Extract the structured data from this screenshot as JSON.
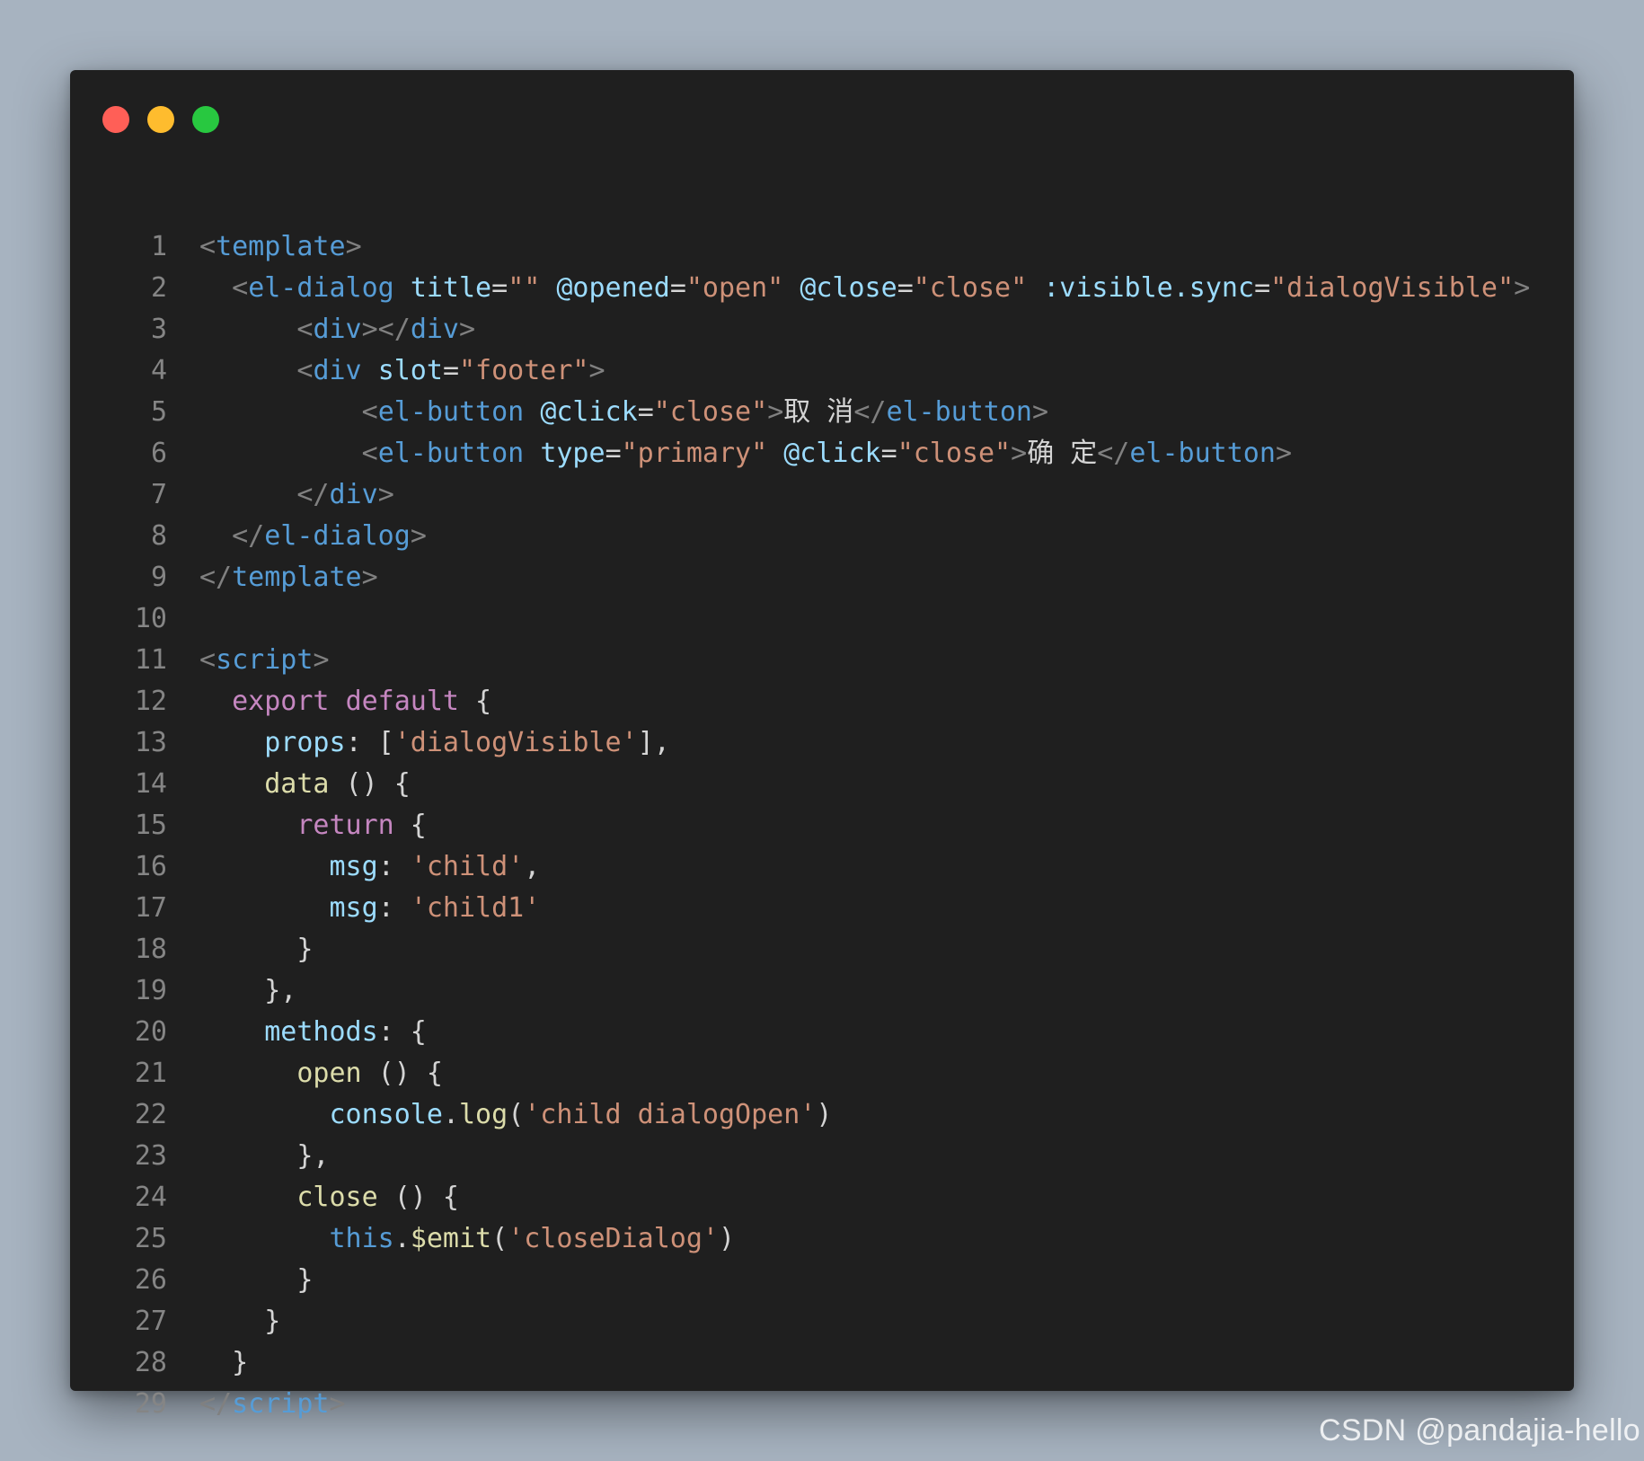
{
  "window": {
    "controls": [
      {
        "name": "close",
        "color": "#ff5f57"
      },
      {
        "name": "minimize",
        "color": "#febc2e"
      },
      {
        "name": "maximize",
        "color": "#28c840"
      }
    ]
  },
  "code": {
    "lines": [
      [
        [
          "p",
          "<"
        ],
        [
          "tg",
          "template"
        ],
        [
          "p",
          ">"
        ]
      ],
      [
        [
          "tx",
          "  "
        ],
        [
          "p",
          "<"
        ],
        [
          "tg",
          "el-dialog"
        ],
        [
          "tx",
          " "
        ],
        [
          "at",
          "title"
        ],
        [
          "eq",
          "="
        ],
        [
          "st",
          "\"\""
        ],
        [
          "tx",
          " "
        ],
        [
          "at",
          "@opened"
        ],
        [
          "eq",
          "="
        ],
        [
          "st",
          "\"open\""
        ],
        [
          "tx",
          " "
        ],
        [
          "at",
          "@close"
        ],
        [
          "eq",
          "="
        ],
        [
          "st",
          "\"close\""
        ],
        [
          "tx",
          " "
        ],
        [
          "at",
          ":visible.sync"
        ],
        [
          "eq",
          "="
        ],
        [
          "st",
          "\"dialogVisible\""
        ],
        [
          "p",
          ">"
        ]
      ],
      [
        [
          "tx",
          "      "
        ],
        [
          "p",
          "<"
        ],
        [
          "tg",
          "div"
        ],
        [
          "p",
          "></"
        ],
        [
          "tg",
          "div"
        ],
        [
          "p",
          ">"
        ]
      ],
      [
        [
          "tx",
          "      "
        ],
        [
          "p",
          "<"
        ],
        [
          "tg",
          "div"
        ],
        [
          "tx",
          " "
        ],
        [
          "at",
          "slot"
        ],
        [
          "eq",
          "="
        ],
        [
          "st",
          "\"footer\""
        ],
        [
          "p",
          ">"
        ]
      ],
      [
        [
          "tx",
          "          "
        ],
        [
          "p",
          "<"
        ],
        [
          "tg",
          "el-button"
        ],
        [
          "tx",
          " "
        ],
        [
          "at",
          "@click"
        ],
        [
          "eq",
          "="
        ],
        [
          "st",
          "\"close\""
        ],
        [
          "p",
          ">"
        ],
        [
          "tx",
          "取 消"
        ],
        [
          "p",
          "</"
        ],
        [
          "tg",
          "el-button"
        ],
        [
          "p",
          ">"
        ]
      ],
      [
        [
          "tx",
          "          "
        ],
        [
          "p",
          "<"
        ],
        [
          "tg",
          "el-button"
        ],
        [
          "tx",
          " "
        ],
        [
          "at",
          "type"
        ],
        [
          "eq",
          "="
        ],
        [
          "st",
          "\"primary\""
        ],
        [
          "tx",
          " "
        ],
        [
          "at",
          "@click"
        ],
        [
          "eq",
          "="
        ],
        [
          "st",
          "\"close\""
        ],
        [
          "p",
          ">"
        ],
        [
          "tx",
          "确 定"
        ],
        [
          "p",
          "</"
        ],
        [
          "tg",
          "el-button"
        ],
        [
          "p",
          ">"
        ]
      ],
      [
        [
          "tx",
          "      "
        ],
        [
          "p",
          "</"
        ],
        [
          "tg",
          "div"
        ],
        [
          "p",
          ">"
        ]
      ],
      [
        [
          "tx",
          "  "
        ],
        [
          "p",
          "</"
        ],
        [
          "tg",
          "el-dialog"
        ],
        [
          "p",
          ">"
        ]
      ],
      [
        [
          "p",
          "</"
        ],
        [
          "tg",
          "template"
        ],
        [
          "p",
          ">"
        ]
      ],
      [],
      [
        [
          "p",
          "<"
        ],
        [
          "tg",
          "script"
        ],
        [
          "p",
          ">"
        ]
      ],
      [
        [
          "tx",
          "  "
        ],
        [
          "kw",
          "export"
        ],
        [
          "tx",
          " "
        ],
        [
          "kw",
          "default"
        ],
        [
          "tx",
          " {"
        ]
      ],
      [
        [
          "tx",
          "    "
        ],
        [
          "pr",
          "props"
        ],
        [
          "tx",
          ": ["
        ],
        [
          "st",
          "'dialogVisible'"
        ],
        [
          "tx",
          "],"
        ]
      ],
      [
        [
          "tx",
          "    "
        ],
        [
          "fn",
          "data"
        ],
        [
          "tx",
          " () {"
        ]
      ],
      [
        [
          "tx",
          "      "
        ],
        [
          "kw",
          "return"
        ],
        [
          "tx",
          " {"
        ]
      ],
      [
        [
          "tx",
          "        "
        ],
        [
          "pr",
          "msg"
        ],
        [
          "tx",
          ": "
        ],
        [
          "st",
          "'child'"
        ],
        [
          "tx",
          ","
        ]
      ],
      [
        [
          "tx",
          "        "
        ],
        [
          "pr",
          "msg"
        ],
        [
          "tx",
          ": "
        ],
        [
          "st",
          "'child1'"
        ]
      ],
      [
        [
          "tx",
          "      }"
        ]
      ],
      [
        [
          "tx",
          "    },"
        ]
      ],
      [
        [
          "tx",
          "    "
        ],
        [
          "pr",
          "methods"
        ],
        [
          "tx",
          ": {"
        ]
      ],
      [
        [
          "tx",
          "      "
        ],
        [
          "fn",
          "open"
        ],
        [
          "tx",
          " () {"
        ]
      ],
      [
        [
          "tx",
          "        "
        ],
        [
          "pr",
          "console"
        ],
        [
          "tx",
          "."
        ],
        [
          "fn",
          "log"
        ],
        [
          "tx",
          "("
        ],
        [
          "st",
          "'child dialogOpen'"
        ],
        [
          "tx",
          ")"
        ]
      ],
      [
        [
          "tx",
          "      },"
        ]
      ],
      [
        [
          "tx",
          "      "
        ],
        [
          "fn",
          "close"
        ],
        [
          "tx",
          " () {"
        ]
      ],
      [
        [
          "tx",
          "        "
        ],
        [
          "bl",
          "this"
        ],
        [
          "tx",
          "."
        ],
        [
          "fn",
          "$emit"
        ],
        [
          "tx",
          "("
        ],
        [
          "st",
          "'closeDialog'"
        ],
        [
          "tx",
          ")"
        ]
      ],
      [
        [
          "tx",
          "      }"
        ]
      ],
      [
        [
          "tx",
          "    }"
        ]
      ],
      [
        [
          "tx",
          "  }"
        ]
      ],
      [
        [
          "p",
          "</"
        ],
        [
          "tg",
          "script"
        ],
        [
          "p",
          ">"
        ]
      ]
    ]
  },
  "watermark": "CSDN @pandajia-hello"
}
